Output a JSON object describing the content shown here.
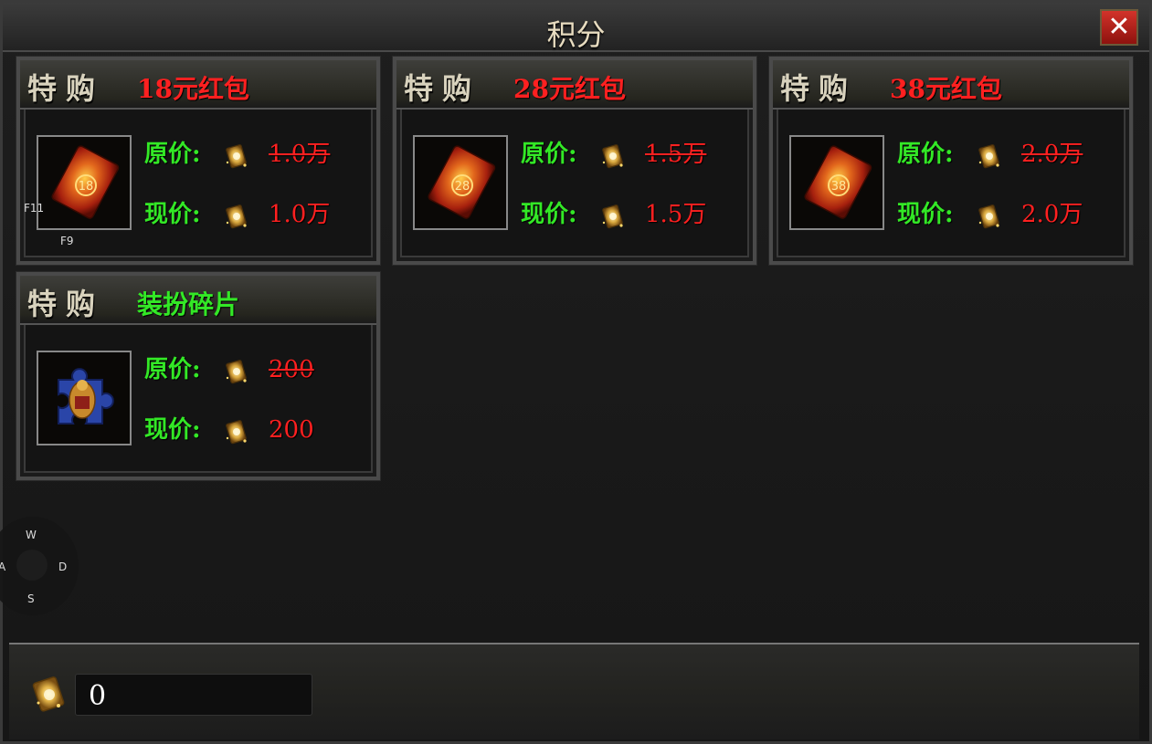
{
  "window": {
    "title": "积分",
    "close_label": "✕"
  },
  "cards": [
    {
      "tag": "特购",
      "name": "18元红包",
      "name_color": "#ff2020",
      "icon": "red-envelope-18-icon",
      "badge": "18",
      "original_label": "原价:",
      "original_price": "1.0万",
      "current_label": "现价:",
      "current_price": "1.0万"
    },
    {
      "tag": "特购",
      "name": "28元红包",
      "name_color": "#ff2020",
      "icon": "red-envelope-28-icon",
      "badge": "28",
      "original_label": "原价:",
      "original_price": "1.5万",
      "current_label": "现价:",
      "current_price": "1.5万"
    },
    {
      "tag": "特购",
      "name": "38元红包",
      "name_color": "#ff2020",
      "icon": "red-envelope-38-icon",
      "badge": "38",
      "original_label": "原价:",
      "original_price": "2.0万",
      "current_label": "现价:",
      "current_price": "2.0万"
    },
    {
      "tag": "特购",
      "name": "装扮碎片",
      "name_color": "#33e826",
      "icon": "costume-fragment-icon",
      "badge": "",
      "original_label": "原价:",
      "original_price": "200",
      "current_label": "现价:",
      "current_price": "200"
    }
  ],
  "hotkeys": {
    "f11": "F11",
    "f9": "F9"
  },
  "joystick": {
    "w": "W",
    "a": "A",
    "s": "S",
    "d": "D"
  },
  "footer": {
    "points": "0",
    "currency_icon": "points-card-icon"
  },
  "colors": {
    "accent_red": "#ff2020",
    "accent_green": "#33e826",
    "close_bg": "#c4261e"
  }
}
